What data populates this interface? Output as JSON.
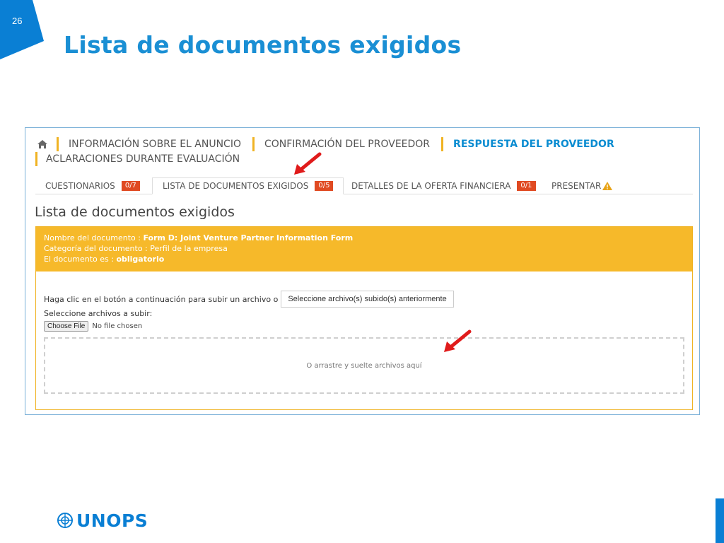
{
  "slide": {
    "number": "26",
    "title": "Lista de documentos exigidos",
    "logo_text": "UNOPS",
    "colors": {
      "accent": "#1a8fd4",
      "corner": "#0a7fd4",
      "warning": "#f6b92a",
      "badge": "#e04a22"
    }
  },
  "nav": {
    "home_icon": "home-icon",
    "items": [
      {
        "label": "INFORMACIÓN SOBRE EL ANUNCIO"
      },
      {
        "label": "CONFIRMACIÓN DEL PROVEEDOR"
      },
      {
        "label": "RESPUESTA DEL PROVEEDOR"
      },
      {
        "label": "ACLARACIONES DURANTE EVALUACIÓN"
      }
    ]
  },
  "tabs": [
    {
      "label": "CUESTIONARIOS",
      "badge": "0/7"
    },
    {
      "label": "LISTA DE DOCUMENTOS EXIGIDOS",
      "badge": "0/5"
    },
    {
      "label": "DETALLES DE LA OFERTA FINANCIERA",
      "badge": "0/1"
    },
    {
      "label": "PRESENTAR",
      "icon": "warning-icon"
    }
  ],
  "content": {
    "heading": "Lista de documentos exigidos",
    "doc_name_label": "Nombre del documento :",
    "doc_name_value": "Form D: Joint Venture Partner Information Form",
    "doc_category_label": "Categoría del documento :",
    "doc_category_value": "Perfil de la empresa",
    "doc_type_label": "El documento es :",
    "doc_type_value": "obligatorio",
    "upload_text": "Haga clic en el botón a continuación para subir un archivo o",
    "prev_files_button": "Seleccione archivo(s) subido(s) anteriormente",
    "select_label": "Seleccione archivos a subir:",
    "choose_file_button": "Choose File",
    "no_file_text": "No file chosen",
    "dropzone_text": "O arrastre y suelte archivos aquí"
  }
}
